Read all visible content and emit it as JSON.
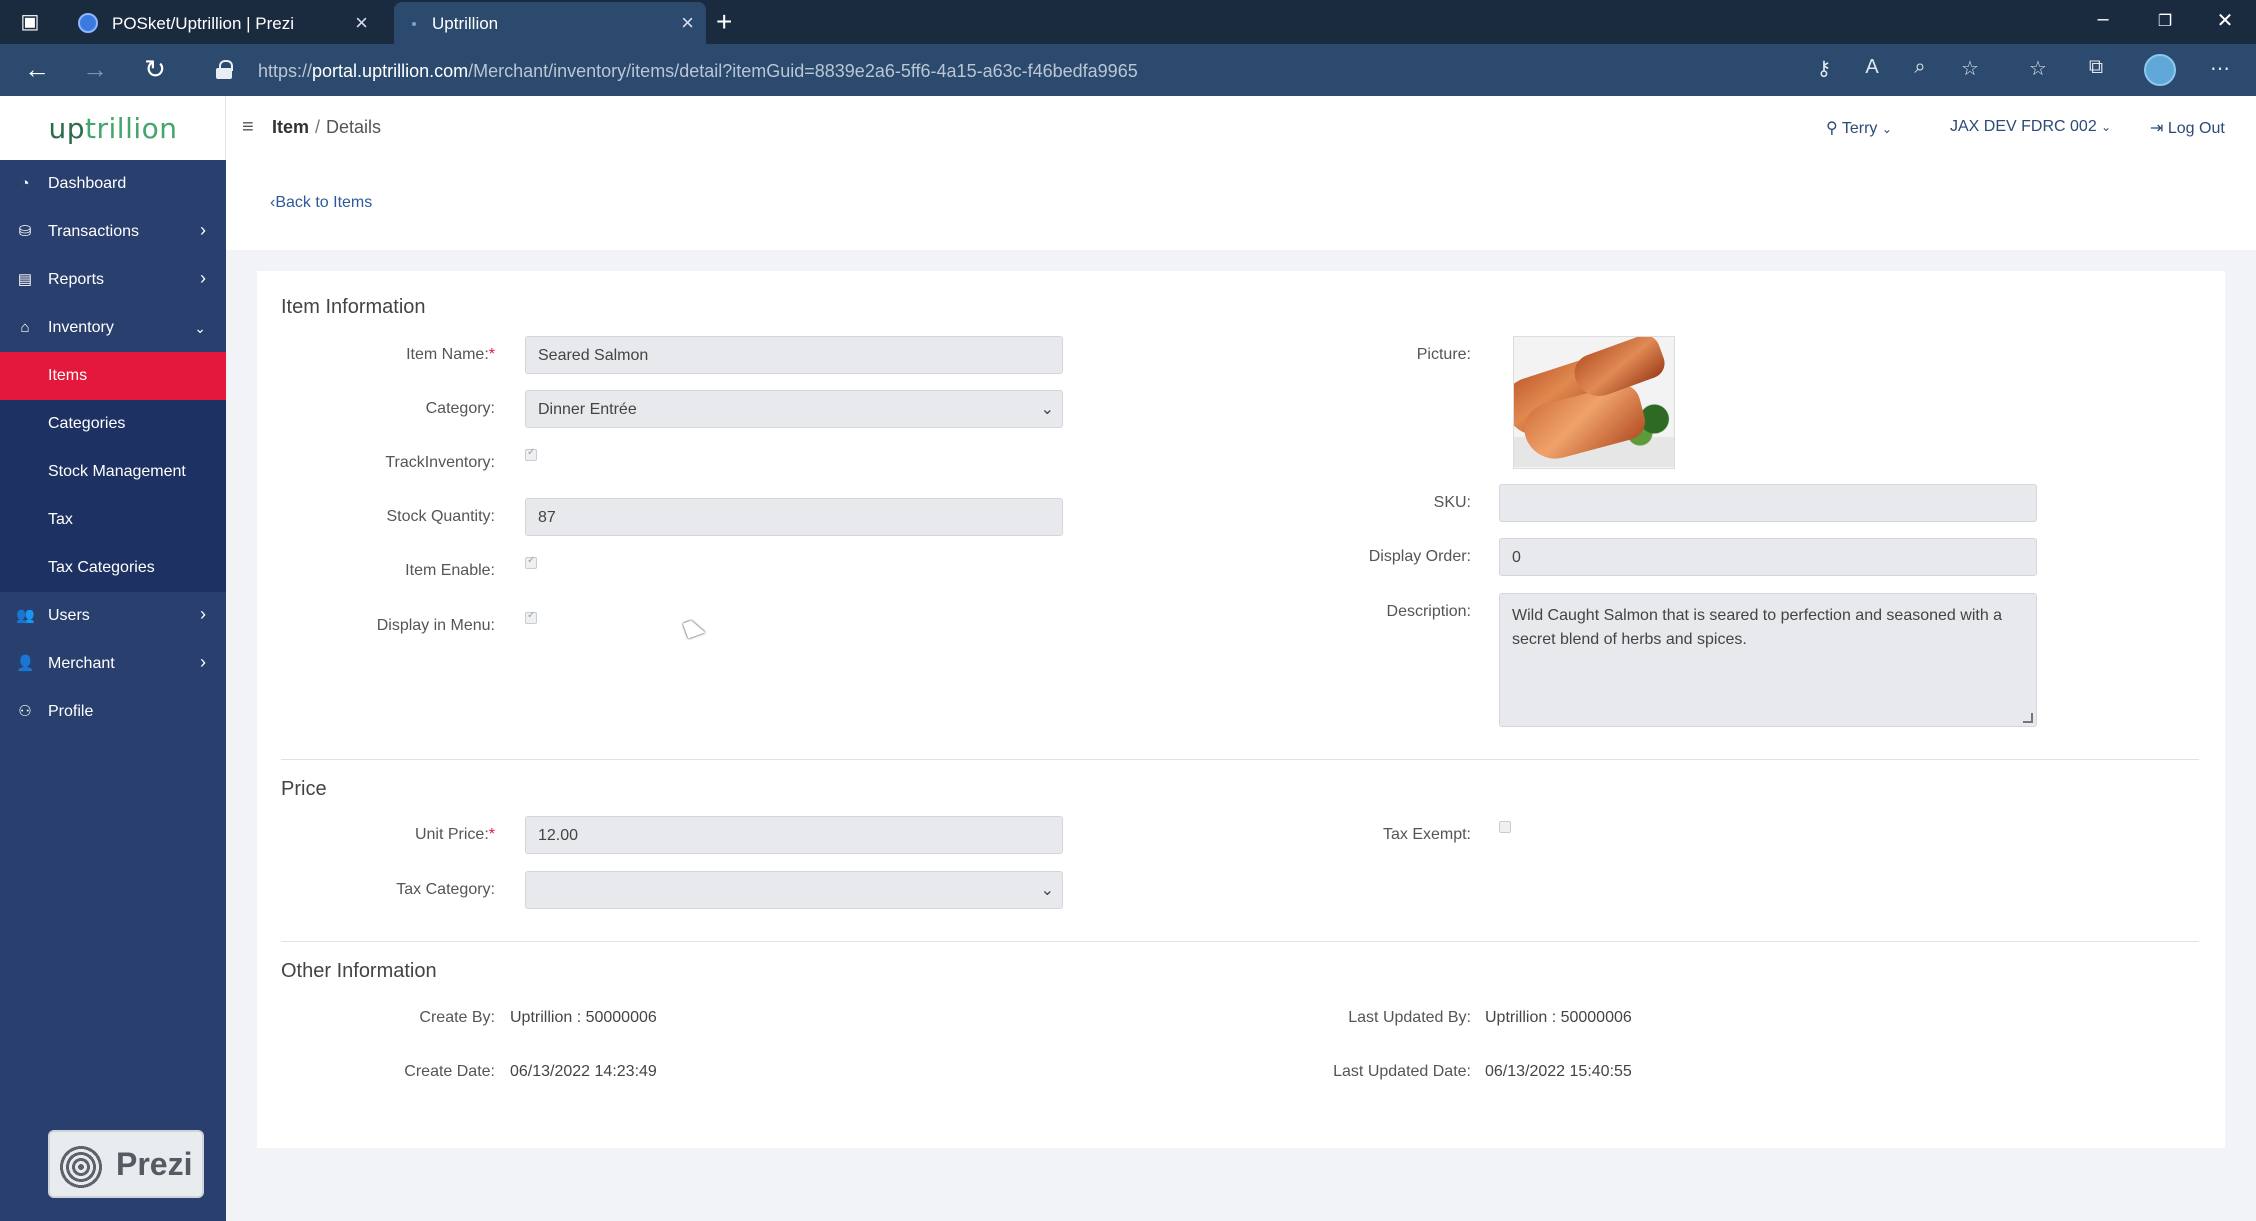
{
  "browser": {
    "tabs": [
      {
        "title": "POSket/Uptrillion | Prezi",
        "active": false
      },
      {
        "title": "Uptrillion",
        "active": true
      }
    ],
    "url": {
      "scheme": "https://",
      "host": "portal.uptrillion.com",
      "path": "/Merchant/inventory/items/detail?itemGuid=8839e2a6-5ff6-4a15-a63c-f46bedfa9965"
    }
  },
  "app": {
    "logo": {
      "part1": "up",
      "part2": "trillion"
    },
    "breadcrumb": {
      "item": "Item",
      "sep": "/",
      "current": "Details"
    },
    "header": {
      "user": "Terry",
      "store": "JAX DEV FDRC 002",
      "logout": "Log Out"
    }
  },
  "sidebar": {
    "items": [
      {
        "label": "Dashboard",
        "icon": "dashboard-icon"
      },
      {
        "label": "Transactions",
        "icon": "transactions-icon"
      },
      {
        "label": "Reports",
        "icon": "reports-icon"
      },
      {
        "label": "Inventory",
        "icon": "inventory-icon"
      }
    ],
    "inventory_sub": [
      {
        "label": "Items",
        "active": true
      },
      {
        "label": "Categories"
      },
      {
        "label": "Stock Management"
      },
      {
        "label": "Tax"
      },
      {
        "label": "Tax Categories"
      }
    ],
    "items_after": [
      {
        "label": "Users",
        "icon": "users-icon"
      },
      {
        "label": "Merchant",
        "icon": "merchant-icon"
      },
      {
        "label": "Profile",
        "icon": "profile-icon"
      }
    ],
    "prezi": "Prezi"
  },
  "page": {
    "back_link": "Back to Items",
    "item_info": {
      "title": "Item Information",
      "item_name_label": "Item Name:",
      "item_name": "Seared Salmon",
      "category_label": "Category:",
      "category": "Dinner Entrée",
      "track_inventory_label": "TrackInventory:",
      "stock_quantity_label": "Stock Quantity:",
      "stock_quantity": "87",
      "item_enable_label": "Item Enable:",
      "display_in_menu_label": "Display in Menu:",
      "picture_label": "Picture:",
      "sku_label": "SKU:",
      "sku": "",
      "display_order_label": "Display Order:",
      "display_order": "0",
      "description_label": "Description:",
      "description": "Wild Caught Salmon that is seared to perfection and seasoned with a secret blend of herbs and spices."
    },
    "price": {
      "title": "Price",
      "unit_price_label": "Unit Price:",
      "unit_price": "12.00",
      "tax_category_label": "Tax Category:",
      "tax_category": "",
      "tax_exempt_label": "Tax Exempt:"
    },
    "other": {
      "title": "Other Information",
      "create_by_label": "Create By:",
      "create_by": "Uptrillion : 50000006",
      "create_date_label": "Create Date:",
      "create_date": "06/13/2022 14:23:49",
      "last_updated_by_label": "Last Updated By:",
      "last_updated_by": "Uptrillion : 50000006",
      "last_updated_date_label": "Last Updated Date:",
      "last_updated_date": "06/13/2022 15:40:55"
    }
  }
}
